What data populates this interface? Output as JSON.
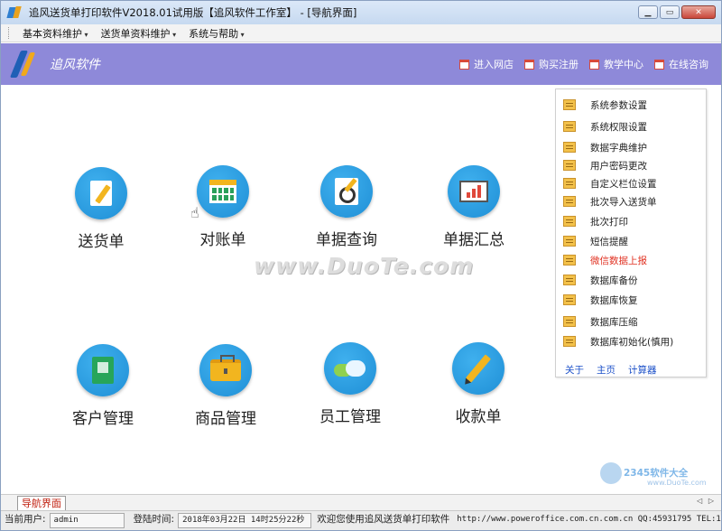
{
  "window": {
    "title": "追风送货单打印软件V2018.01试用版【追风软件工作室】 - [导航界面]",
    "minimize_glyph": "▁",
    "maximize_glyph": "▭",
    "close_glyph": "✕"
  },
  "menubar": {
    "items": [
      "基本资料维护",
      "送货单资料维护",
      "系统与帮助"
    ]
  },
  "banner": {
    "brand": "追风软件",
    "links": [
      "进入网店",
      "购买注册",
      "教学中心",
      "在线咨询"
    ]
  },
  "tiles": [
    {
      "label": "送货单",
      "icon": "document-pen-icon"
    },
    {
      "label": "对账单",
      "icon": "calendar-icon"
    },
    {
      "label": "单据查询",
      "icon": "magnifier-icon"
    },
    {
      "label": "单据汇总",
      "icon": "presentation-board-icon"
    },
    {
      "label": "客户管理",
      "icon": "address-book-icon"
    },
    {
      "label": "商品管理",
      "icon": "briefcase-icon"
    },
    {
      "label": "员工管理",
      "icon": "cloud-icon"
    },
    {
      "label": "收款单",
      "icon": "pencil-icon"
    }
  ],
  "watermark": "www.DuoTe.com",
  "side_panel": {
    "items": [
      {
        "label": "系统参数设置"
      },
      {
        "label": "系统权限设置"
      },
      {
        "label": "数据字典维护"
      },
      {
        "label": "用户密码更改"
      },
      {
        "label": "自定义栏位设置"
      },
      {
        "label": "批次导入送货单"
      },
      {
        "label": "批次打印"
      },
      {
        "label": "短信提醒"
      },
      {
        "label": "微信数据上报",
        "highlight_color": "#e03020"
      },
      {
        "label": "数据库备份"
      },
      {
        "label": "数据库恢复"
      },
      {
        "label": "数据库压缩"
      },
      {
        "label": "数据库初始化(慎用)"
      }
    ],
    "links": [
      "关于",
      "主页",
      "计算器"
    ]
  },
  "corner_watermark": {
    "text": "2345软件大全",
    "sub": "www.DuoTe.com"
  },
  "tabbar": {
    "active_tab": "导航界面",
    "arrows": "◁ ▷"
  },
  "statusbar": {
    "user_label": "当前用户:",
    "user_value": "admin",
    "login_label": "登陆时间:",
    "login_value": "2018年03月22日 14时25分22秒",
    "welcome": "欢迎您使用追风送货单打印软件",
    "contact": "http://www.poweroffice.com.cn.com.cn QQ:45931795 TEL:1"
  }
}
